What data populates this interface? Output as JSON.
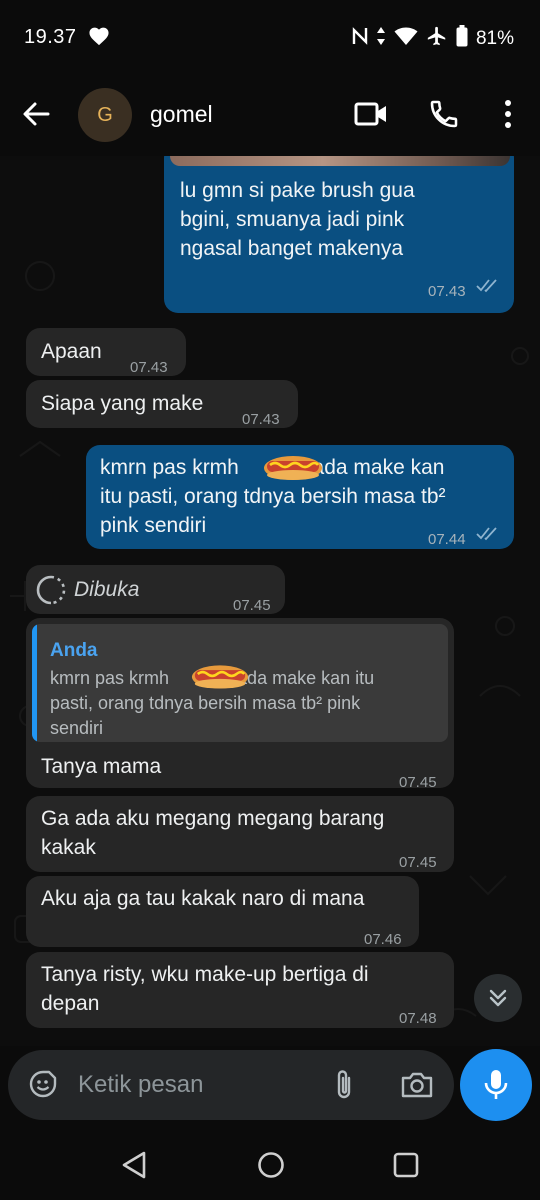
{
  "status": {
    "time": "19.37",
    "battery": "81%"
  },
  "header": {
    "avatar_letter": "G",
    "contact_name": "gomel"
  },
  "messages": [
    {
      "id": "m1",
      "direction": "out",
      "text": "lu gmn si pake brush gua bgini, smuanya jadi pink ngasal banget makenya",
      "time": "07.43",
      "status": "read"
    },
    {
      "id": "m2",
      "direction": "in",
      "text": "Apaan",
      "time": "07.43"
    },
    {
      "id": "m3",
      "direction": "in",
      "text": "Siapa yang make",
      "time": "07.43"
    },
    {
      "id": "m4",
      "direction": "out",
      "text": "kmrn pas krmh 🌭 pada make kan itu pasti, orang tdnya bersih masa tb² pink sendiri",
      "time": "07.44",
      "status": "read"
    },
    {
      "id": "m5",
      "direction": "in",
      "text": "Dibuka",
      "time": "07.45",
      "type": "view-once"
    },
    {
      "id": "m6",
      "direction": "in",
      "quote_author": "Anda",
      "quote_text": "kmrn pas krmh 🌭 pada make kan itu pasti, orang tdnya bersih masa tb² pink sendiri",
      "text": "Tanya mama",
      "time": "07.45"
    },
    {
      "id": "m7",
      "direction": "in",
      "text": "Ga ada aku megang megang barang kakak",
      "time": "07.45"
    },
    {
      "id": "m8",
      "direction": "in",
      "text": "Aku aja ga tau kakak naro di mana",
      "time": "07.46"
    },
    {
      "id": "m9",
      "direction": "in",
      "text": "Tanya risty, wku make-up bertiga di depan",
      "time": "07.48"
    }
  ],
  "display": {
    "m1_lines": [
      "lu gmn si pake brush gua",
      "bgini, smuanya jadi pink",
      "ngasal banget makenya"
    ],
    "m4_lines": [
      "kmrn pas krmh",
      "pada make kan",
      "itu pasti, orang tdnya bersih masa tb²",
      "pink sendiri"
    ],
    "m6_quote_lines": [
      "kmrn pas krmh",
      "pada make kan itu",
      "pasti, orang tdnya bersih masa tb² pink",
      "sendiri"
    ],
    "m7_lines": [
      "Ga ada aku megang megang barang",
      "kakak"
    ],
    "m9_lines": [
      "Tanya risty, wku make-up bertiga di",
      "depan"
    ]
  },
  "composer": {
    "placeholder": "Ketik pesan"
  },
  "colors": {
    "outgoing_bubble": "#0a4f81",
    "incoming_bubble": "#262626",
    "accent": "#1d8ff0",
    "quote_author": "#4aa3f0"
  },
  "icons": {
    "status": [
      "heart-icon",
      "nfc-icon",
      "data-arrows-icon",
      "wifi-icon",
      "airplane-icon",
      "battery-icon"
    ],
    "header": [
      "back-arrow-icon",
      "video-camera-icon",
      "phone-icon",
      "more-vertical-icon"
    ],
    "composer": [
      "emoji-icon",
      "paperclip-icon",
      "camera-icon",
      "microphone-icon"
    ],
    "nav": [
      "nav-back-icon",
      "nav-home-icon",
      "nav-recents-icon"
    ]
  }
}
